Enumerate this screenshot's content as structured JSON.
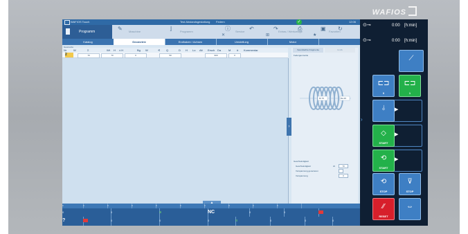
{
  "brand": {
    "name": "WAFIOS"
  },
  "topbar": {
    "app_title": "WAFIOS Touch",
    "program_name": "Test Abstandsgestaltung",
    "mode": "Federn",
    "time": "12:06"
  },
  "toolbar": {
    "program_label": "Programm",
    "tools": [
      "Maschine",
      "Programm",
      "Service",
      "Extras / Werkzeuge",
      "Favoriten"
    ]
  },
  "tabs": [
    {
      "label": "Katalog",
      "active": false
    },
    {
      "label": "Geometrie",
      "active": true
    },
    {
      "label": "Endhaken / Achsen",
      "active": false
    },
    {
      "label": "Umstellung",
      "active": false
    },
    {
      "label": "Motor",
      "active": false
    }
  ],
  "grid": {
    "section_label": "Geometrie",
    "columns": [
      "Nr",
      "W",
      "Σ",
      "Wt",
      "H",
      "± H",
      "Bg",
      "W",
      "∢",
      "Q",
      "D",
      "H",
      "Lo",
      "Alt",
      "Ersch",
      "Da",
      "M",
      "#",
      "Kommentar"
    ],
    "rows": [
      {
        "index": "2",
        "cells": [
          "70",
          "70",
          "0",
          "50",
          "900",
          "0"
        ]
      }
    ]
  },
  "preview": {
    "tab_active": "Vereinfachte Fragmente",
    "tab_inactive": "Grafik",
    "title": "Federgeometrie",
    "spring_label_left": "Di  70",
    "spring_label_right": "Da  20",
    "section": "Geschwindigkeit",
    "params": [
      {
        "label": "Geschwindigkeit",
        "unit": "cb",
        "value": "70"
      },
      {
        "label": "Vorspannung generieren",
        "type": "checkbox"
      },
      {
        "label": "Vorspannung",
        "value": "0"
      }
    ]
  },
  "status": {
    "row1": [
      "0",
      "0",
      "0",
      "0",
      "0",
      "0",
      "0",
      "0",
      "0",
      "0"
    ],
    "row2": [
      "0",
      "0",
      "NC",
      "0",
      "0",
      "0",
      "0"
    ],
    "row3": [
      "?",
      "0",
      "0",
      "0",
      "0",
      "0",
      "0",
      "0",
      "0"
    ]
  },
  "side": {
    "clock1": {
      "value": "0:00",
      "unit": "[h:min]"
    },
    "clock2": {
      "value": "0:00",
      "unit": "[h:min]"
    },
    "buttons": {
      "zero": "0",
      "one": "1",
      "start1": "START",
      "start2": "START",
      "stop1": "STOP",
      "stop2": "STOP",
      "reset": "RESET"
    }
  },
  "colors": {
    "accent": "#3a73b0",
    "dark_panel": "#0f1f33",
    "start_green": "#23b14a",
    "reset_red": "#d71f2b"
  }
}
